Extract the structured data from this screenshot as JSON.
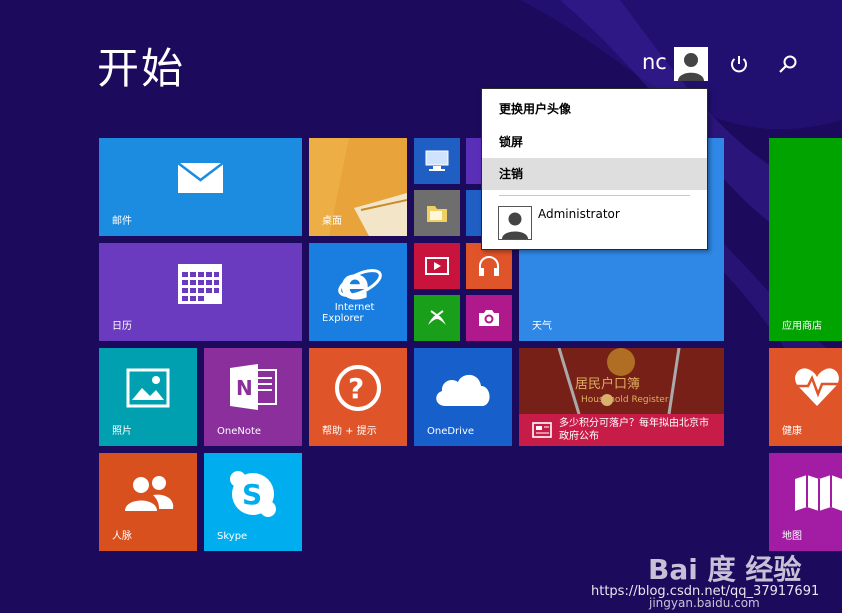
{
  "screen": {
    "title": "开始"
  },
  "user": {
    "name": "nc",
    "menu": {
      "items": [
        "更换用户头像",
        "锁屏",
        "注销"
      ],
      "highlighted_index": 2,
      "account_name": "Administrator"
    }
  },
  "tiles": {
    "mail": "邮件",
    "desktop": "桌面",
    "calendar": "日历",
    "ie": "Internet\nExplorer",
    "weather": "天气",
    "store": "应用商店",
    "photos": "照片",
    "onenote": "OneNote",
    "help": "帮助 + 提示",
    "onedrive": "OneDrive",
    "news": "多少积分可落户？每年拟由北京市政府公布",
    "health": "健康",
    "people": "人脉",
    "skype": "Skype",
    "maps": "地图"
  },
  "news_image_text": {
    "line1": "居民户口簿",
    "line2": "Household Register"
  },
  "watermark": {
    "logo": "Bai 度 经验",
    "site": "jingyan.baidu.com",
    "url": "https://blog.csdn.net/qq_37917691"
  },
  "colors": {
    "background": "#1c0a5c",
    "mail": "#1c8ce0",
    "desktop": "#e8a33b",
    "calendar": "#6a3bbf",
    "ie": "#1a7ee0",
    "weather": "#2f88e6",
    "store": "#00a300",
    "photos": "#00a0b0",
    "onenote": "#8a2f9c",
    "help": "#e0542a",
    "onedrive": "#1760cc",
    "news": "#c81c48",
    "health": "#e0542a",
    "people": "#d9501f",
    "skype": "#00aef0",
    "maps": "#a21ca4",
    "small_pc": "#1f5fc4",
    "small_files": "#6e6e6e",
    "small_video": "#c8143c",
    "small_music": "#e0542a",
    "small_games": "#1a9f1a",
    "small_camera": "#b0198c"
  }
}
